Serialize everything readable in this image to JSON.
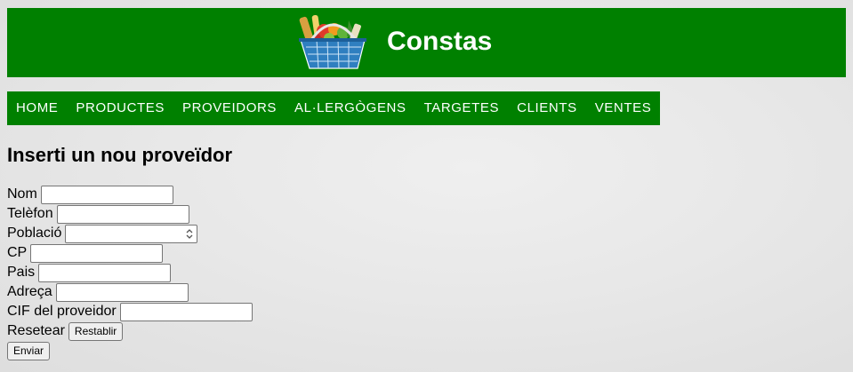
{
  "header": {
    "title": "Constas",
    "logo_icon": "shopping-basket-icon",
    "background_color": "#008000"
  },
  "nav": {
    "items": [
      {
        "label": "HOME"
      },
      {
        "label": "PRODUCTES"
      },
      {
        "label": "PROVEIDORS"
      },
      {
        "label": "AL·LERGÒGENS"
      },
      {
        "label": "TARGETES"
      },
      {
        "label": "CLIENTS"
      },
      {
        "label": "VENTES"
      }
    ]
  },
  "main": {
    "heading": "Inserti un nou proveïdor"
  },
  "form": {
    "fields": [
      {
        "label": "Nom",
        "value": ""
      },
      {
        "label": "Telèfon",
        "value": ""
      },
      {
        "label": "Població",
        "value": ""
      },
      {
        "label": "CP",
        "value": ""
      },
      {
        "label": "Pais",
        "value": ""
      },
      {
        "label": "Adreça",
        "value": ""
      },
      {
        "label": "CIF del proveidor",
        "value": ""
      }
    ],
    "reset_label": "Resetear",
    "reset_button": "Restablir",
    "submit_button": "Enviar"
  }
}
